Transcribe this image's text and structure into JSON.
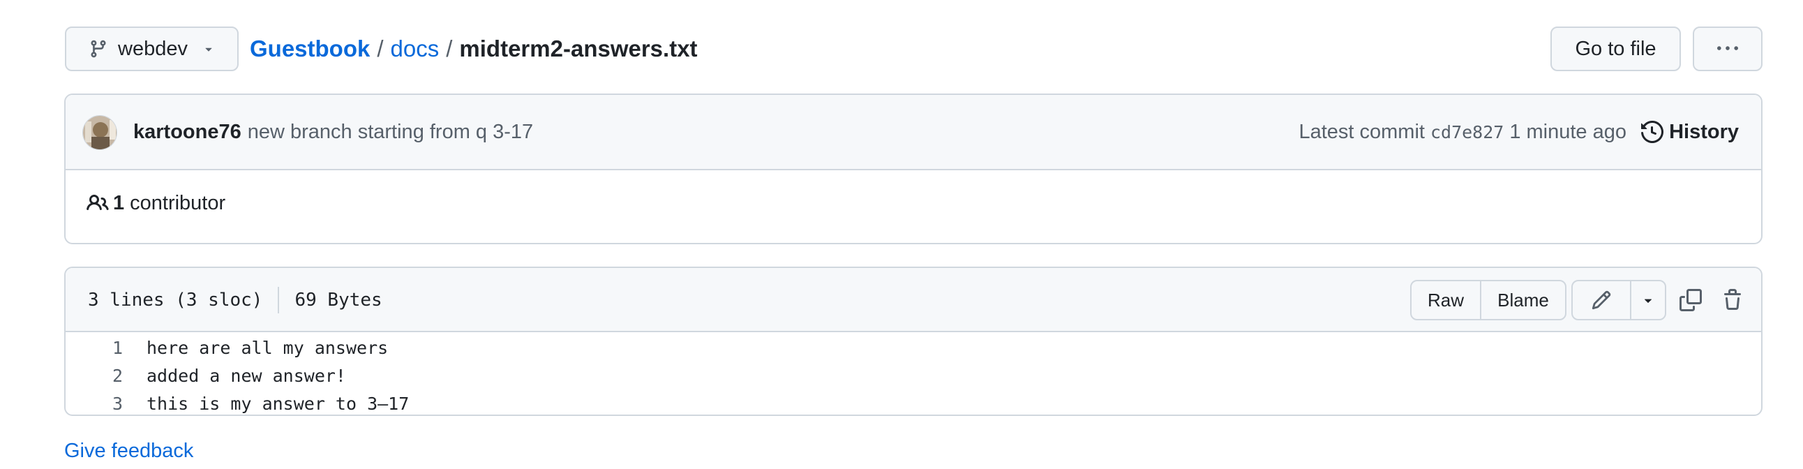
{
  "branch": {
    "name": "webdev"
  },
  "breadcrumb": {
    "repo": "Guestbook",
    "sep1": "/",
    "folder": "docs",
    "sep2": "/",
    "file": "midterm2-answers.txt"
  },
  "header": {
    "go_to_file": "Go to file"
  },
  "commit": {
    "author": "kartoone76",
    "message": "new branch starting from q 3-17",
    "latest_label": "Latest commit",
    "sha": "cd7e827",
    "time": "1 minute ago",
    "history_label": "History"
  },
  "contributors": {
    "count": "1",
    "label": "contributor"
  },
  "file_info": {
    "lines": "3 lines (3 sloc)",
    "size": "69 Bytes"
  },
  "toolbar": {
    "raw_label": "Raw",
    "blame_label": "Blame"
  },
  "code": {
    "line_numbers": [
      "1",
      "2",
      "3"
    ],
    "lines": [
      "here are all my answers",
      "added a new answer!",
      "this is my answer to 3–17"
    ]
  },
  "footer": {
    "feedback": "Give feedback"
  },
  "colors": {
    "link": "#0969da",
    "border": "#d0d7de",
    "subtle_bg": "#f6f8fa",
    "muted_text": "#57606a"
  },
  "icons": [
    "git-branch-icon",
    "triangle-down-icon",
    "kebab-horizontal-icon",
    "history-icon",
    "people-icon",
    "pencil-icon",
    "copy-icon",
    "trash-icon"
  ]
}
